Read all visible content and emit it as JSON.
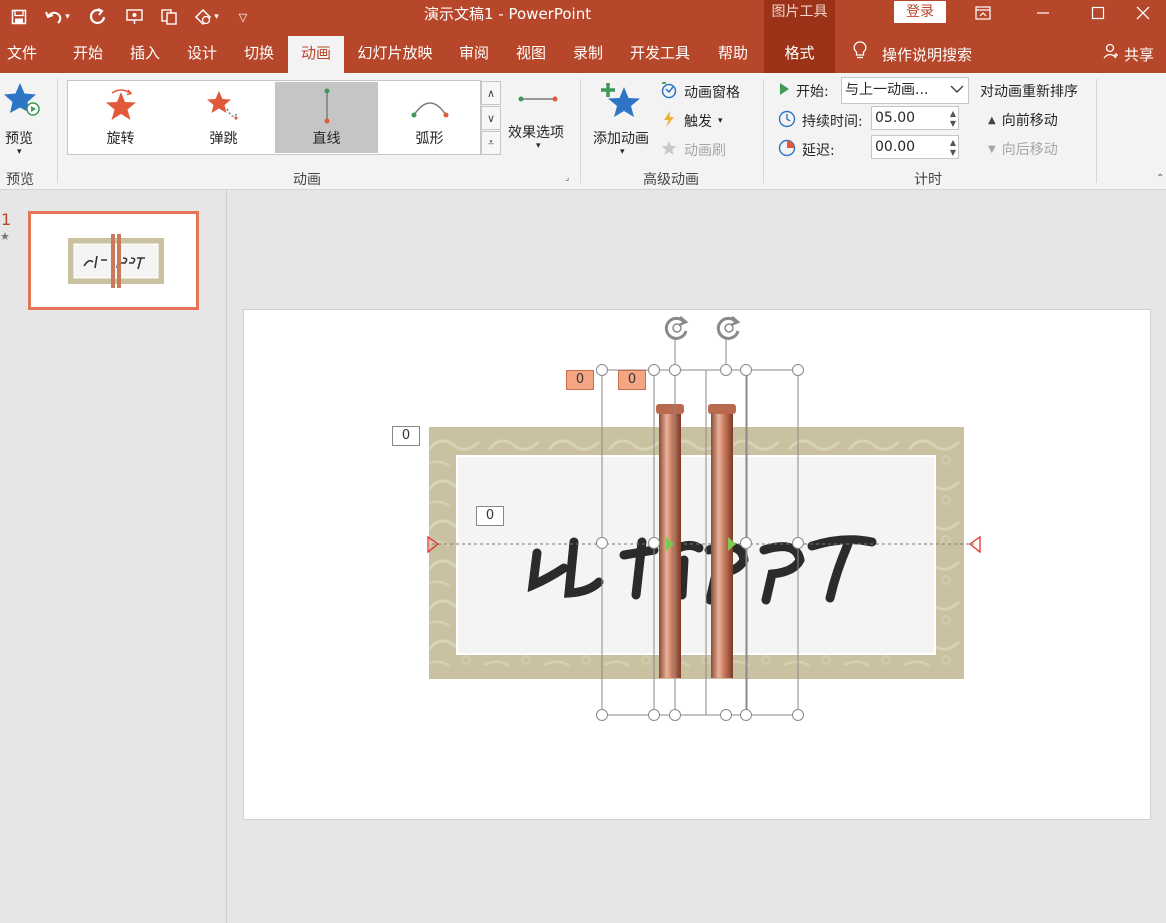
{
  "title_bar": {
    "document_title": "演示文稿1  -  PowerPoint",
    "contextual_tab_group": "图片工具",
    "login_label": "登录"
  },
  "tabs": [
    {
      "label": "文件",
      "active": false
    },
    {
      "label": "开始",
      "active": false
    },
    {
      "label": "插入",
      "active": false
    },
    {
      "label": "设计",
      "active": false
    },
    {
      "label": "切换",
      "active": false
    },
    {
      "label": "动画",
      "active": true
    },
    {
      "label": "幻灯片放映",
      "active": false
    },
    {
      "label": "审阅",
      "active": false
    },
    {
      "label": "视图",
      "active": false
    },
    {
      "label": "录制",
      "active": false
    },
    {
      "label": "开发工具",
      "active": false
    },
    {
      "label": "帮助",
      "active": false
    },
    {
      "label": "格式",
      "active": false
    }
  ],
  "tell_me": "操作说明搜索",
  "share": "共享",
  "ribbon": {
    "preview": {
      "label": "预览",
      "group": "预览"
    },
    "animation_gallery": {
      "items": [
        {
          "label": "旋转",
          "selected": false
        },
        {
          "label": "弹跳",
          "selected": false
        },
        {
          "label": "直线",
          "selected": true
        },
        {
          "label": "弧形",
          "selected": false
        }
      ],
      "effect_options": "效果选项",
      "group": "动画"
    },
    "advanced": {
      "add_animation": "添加动画",
      "animation_pane": "动画窗格",
      "trigger": "触发",
      "animation_painter": "动画刷",
      "group": "高级动画"
    },
    "timing": {
      "start_label": "开始:",
      "start_value": "与上一动画...",
      "duration_label": "持续时间:",
      "duration_value": "05.00",
      "delay_label": "延迟:",
      "delay_value": "00.00",
      "reorder_title": "对动画重新排序",
      "move_earlier": "向前移动",
      "move_later": "向后移动",
      "group": "计时"
    }
  },
  "thumbnails": {
    "slide_number": "1",
    "has_animation_marker": "★"
  },
  "slide": {
    "banner_text": "比 格 PPT",
    "animation_tags": {
      "left_rod": "0",
      "right_rod": "0",
      "banner": "0",
      "text": "0"
    }
  },
  "colors": {
    "accent": "#b7472a",
    "contextual": "#9c3318",
    "tag_fill": "#f4a683",
    "copper": "#c97a5c",
    "banner_frame": "#c9c1a0"
  }
}
